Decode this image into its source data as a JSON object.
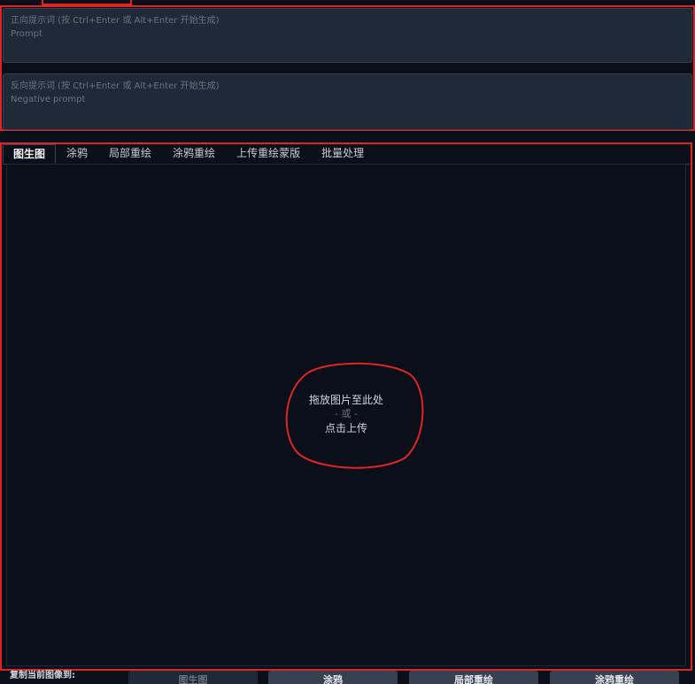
{
  "prompt": {
    "positive_label": "正向提示词 (按 Ctrl+Enter 或 Alt+Enter 开始生成)",
    "positive_placeholder": "Prompt",
    "negative_label": "反向提示词 (按 Ctrl+Enter 或 Alt+Enter 开始生成)",
    "negative_placeholder": "Negative prompt"
  },
  "img2img": {
    "tabs": [
      {
        "label": "图生图",
        "active": true
      },
      {
        "label": "涂鸦",
        "active": false
      },
      {
        "label": "局部重绘",
        "active": false
      },
      {
        "label": "涂鸦重绘",
        "active": false
      },
      {
        "label": "上传重绘蒙版",
        "active": false
      },
      {
        "label": "批量处理",
        "active": false
      }
    ],
    "upload": {
      "line1": "拖放图片至此处",
      "line2": "- 或 -",
      "line3": "点击上传"
    }
  },
  "copy_bar": {
    "label": "复制当前图像到:",
    "buttons": [
      {
        "label": "图生图",
        "disabled": true
      },
      {
        "label": "涂鸦",
        "disabled": false
      },
      {
        "label": "局部重绘",
        "disabled": false
      },
      {
        "label": "涂鸦重绘",
        "disabled": false
      }
    ]
  },
  "colors": {
    "background": "#0b0f19",
    "panel": "#1f2937",
    "annotation_red": "#e02424"
  }
}
